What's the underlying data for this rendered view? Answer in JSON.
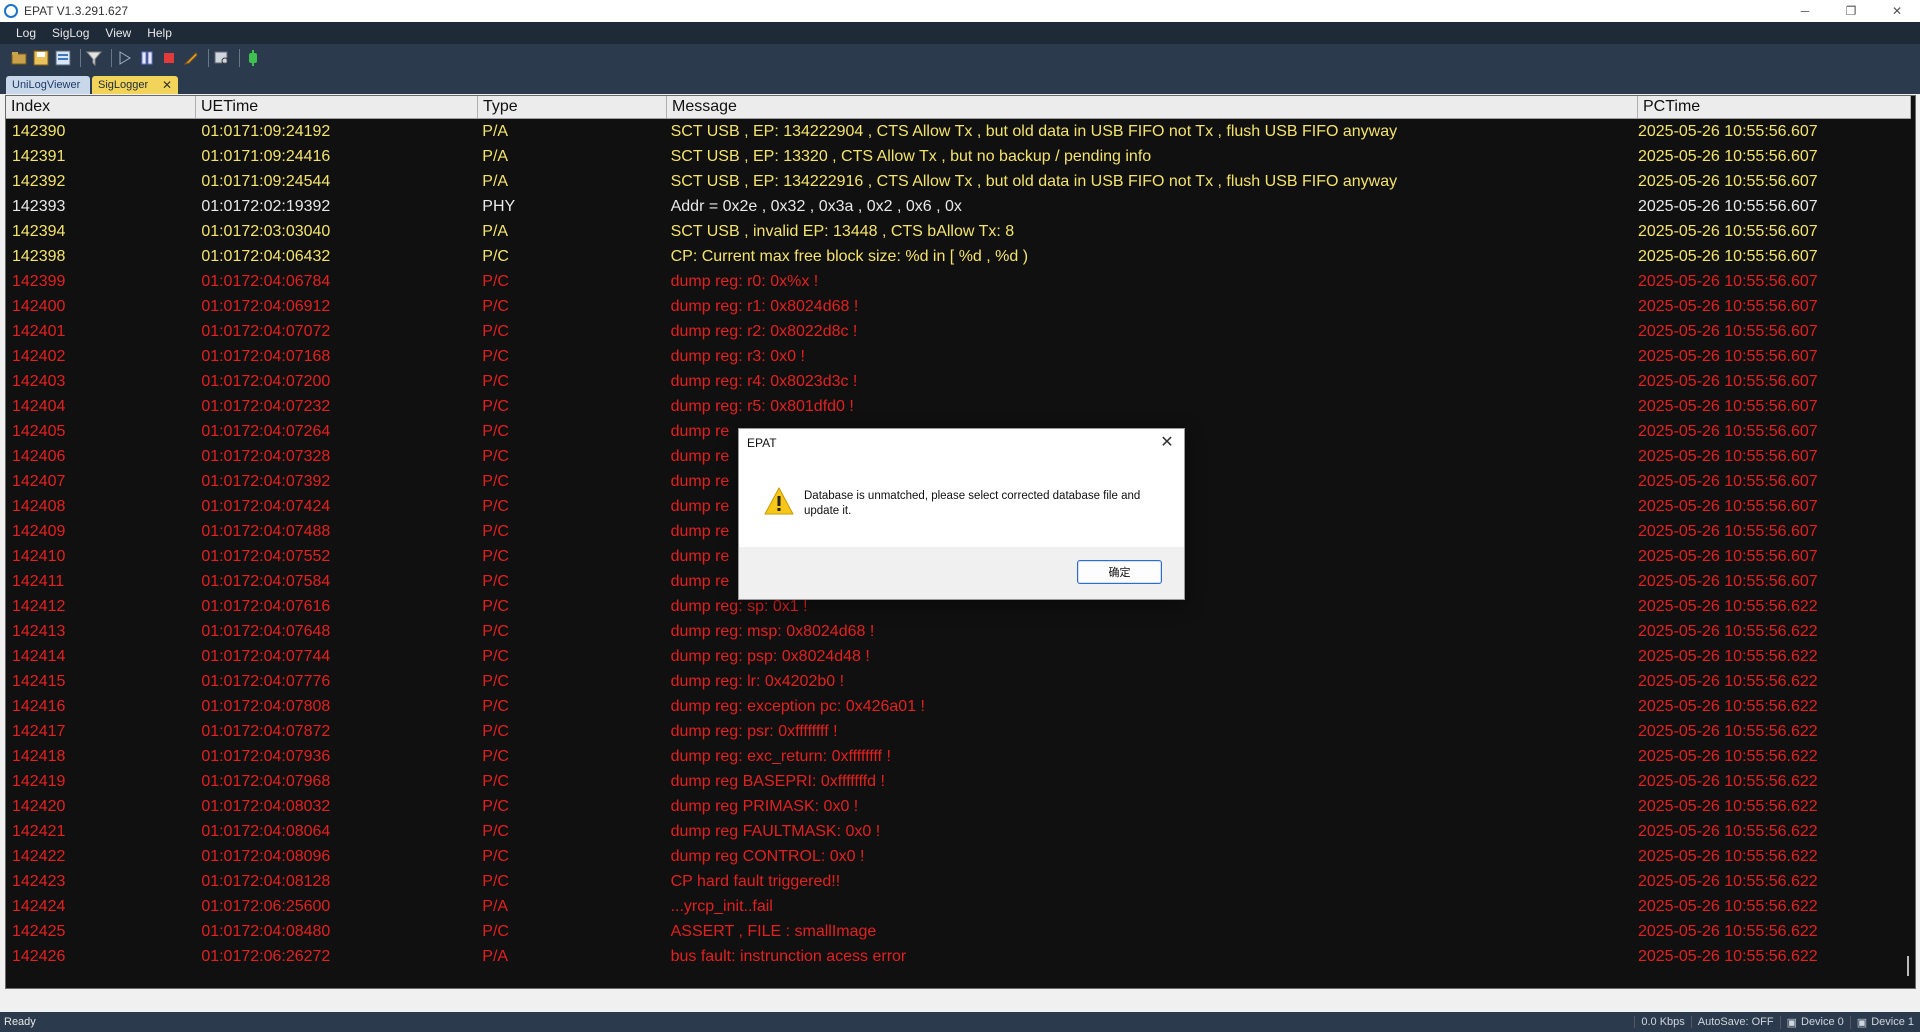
{
  "window": {
    "title": "EPAT V1.3.291.627",
    "controls": [
      "─",
      "❐",
      "✕"
    ]
  },
  "menu": {
    "items": [
      "Log",
      "SigLog",
      "View",
      "Help"
    ]
  },
  "toolbar": {
    "icons": [
      "open-folder-icon",
      "save-icon",
      "database-icon",
      "filter-icon",
      "play-icon",
      "pause-icon",
      "stop-icon",
      "tool-icon",
      "find-icon",
      "device-icon"
    ]
  },
  "tabs": [
    {
      "label": "UniLogViewer"
    },
    {
      "label": "SigLogger",
      "close": "✕"
    }
  ],
  "grid": {
    "columns": [
      "Index",
      "UETime",
      "Type",
      "Message",
      "PCTime"
    ],
    "rows": [
      {
        "level": "yellow",
        "index": "142390",
        "uetime": "01:0171:09:24192",
        "type": "P/A",
        "message": "SCT USB , EP: 134222904 , CTS Allow Tx , but old data in USB FIFO not Tx , flush USB FIFO anyway",
        "pctime": "2025-05-26 10:55:56.607"
      },
      {
        "level": "yellow",
        "index": "142391",
        "uetime": "01:0171:09:24416",
        "type": "P/A",
        "message": "SCT USB , EP: 13320 , CTS Allow Tx , but no backup / pending info",
        "pctime": "2025-05-26 10:55:56.607"
      },
      {
        "level": "yellow",
        "index": "142392",
        "uetime": "01:0171:09:24544",
        "type": "P/A",
        "message": "SCT USB , EP: 134222916 , CTS Allow Tx , but old data in USB FIFO not Tx , flush USB FIFO anyway",
        "pctime": "2025-05-26 10:55:56.607"
      },
      {
        "level": "white",
        "index": "142393",
        "uetime": "01:0172:02:19392",
        "type": "PHY",
        "message": "Addr = 0x2e , 0x32 , 0x3a , 0x2 , 0x6 , 0x",
        "pctime": "2025-05-26 10:55:56.607"
      },
      {
        "level": "yellow",
        "index": "142394",
        "uetime": "01:0172:03:03040",
        "type": "P/A",
        "message": "SCT USB , invalid EP: 13448 , CTS bAllow Tx: 8",
        "pctime": "2025-05-26 10:55:56.607"
      },
      {
        "level": "yellow",
        "index": "142398",
        "uetime": "01:0172:04:06432",
        "type": "P/C",
        "message": "CP: Current max free block size: %d in [ %d , %d )",
        "pctime": "2025-05-26 10:55:56.607"
      },
      {
        "level": "red",
        "index": "142399",
        "uetime": "01:0172:04:06784",
        "type": "P/C",
        "message": "dump reg: r0: 0x%x !",
        "pctime": "2025-05-26 10:55:56.607"
      },
      {
        "level": "red",
        "index": "142400",
        "uetime": "01:0172:04:06912",
        "type": "P/C",
        "message": "dump reg: r1: 0x8024d68 !",
        "pctime": "2025-05-26 10:55:56.607"
      },
      {
        "level": "red",
        "index": "142401",
        "uetime": "01:0172:04:07072",
        "type": "P/C",
        "message": "dump reg: r2: 0x8022d8c !",
        "pctime": "2025-05-26 10:55:56.607"
      },
      {
        "level": "red",
        "index": "142402",
        "uetime": "01:0172:04:07168",
        "type": "P/C",
        "message": "dump reg: r3: 0x0 !",
        "pctime": "2025-05-26 10:55:56.607"
      },
      {
        "level": "red",
        "index": "142403",
        "uetime": "01:0172:04:07200",
        "type": "P/C",
        "message": "dump reg: r4: 0x8023d3c !",
        "pctime": "2025-05-26 10:55:56.607"
      },
      {
        "level": "red",
        "index": "142404",
        "uetime": "01:0172:04:07232",
        "type": "P/C",
        "message": "dump reg: r5: 0x801dfd0 !",
        "pctime": "2025-05-26 10:55:56.607"
      },
      {
        "level": "red",
        "index": "142405",
        "uetime": "01:0172:04:07264",
        "type": "P/C",
        "message": "dump re",
        "pctime": "2025-05-26 10:55:56.607"
      },
      {
        "level": "red",
        "index": "142406",
        "uetime": "01:0172:04:07328",
        "type": "P/C",
        "message": "dump re",
        "pctime": "2025-05-26 10:55:56.607"
      },
      {
        "level": "red",
        "index": "142407",
        "uetime": "01:0172:04:07392",
        "type": "P/C",
        "message": "dump re",
        "pctime": "2025-05-26 10:55:56.607"
      },
      {
        "level": "red",
        "index": "142408",
        "uetime": "01:0172:04:07424",
        "type": "P/C",
        "message": "dump re",
        "pctime": "2025-05-26 10:55:56.607"
      },
      {
        "level": "red",
        "index": "142409",
        "uetime": "01:0172:04:07488",
        "type": "P/C",
        "message": "dump re",
        "pctime": "2025-05-26 10:55:56.607"
      },
      {
        "level": "red",
        "index": "142410",
        "uetime": "01:0172:04:07552",
        "type": "P/C",
        "message": "dump re",
        "pctime": "2025-05-26 10:55:56.607"
      },
      {
        "level": "red",
        "index": "142411",
        "uetime": "01:0172:04:07584",
        "type": "P/C",
        "message": "dump re",
        "pctime": "2025-05-26 10:55:56.607"
      },
      {
        "level": "red",
        "index": "142412",
        "uetime": "01:0172:04:07616",
        "type": "P/C",
        "message": "dump reg: sp: 0x1 !",
        "pctime": "2025-05-26 10:55:56.622"
      },
      {
        "level": "red",
        "index": "142413",
        "uetime": "01:0172:04:07648",
        "type": "P/C",
        "message": "dump reg: msp: 0x8024d68 !",
        "pctime": "2025-05-26 10:55:56.622"
      },
      {
        "level": "red",
        "index": "142414",
        "uetime": "01:0172:04:07744",
        "type": "P/C",
        "message": "dump reg: psp: 0x8024d48 !",
        "pctime": "2025-05-26 10:55:56.622"
      },
      {
        "level": "red",
        "index": "142415",
        "uetime": "01:0172:04:07776",
        "type": "P/C",
        "message": "dump reg: lr: 0x4202b0 !",
        "pctime": "2025-05-26 10:55:56.622"
      },
      {
        "level": "red",
        "index": "142416",
        "uetime": "01:0172:04:07808",
        "type": "P/C",
        "message": "dump reg: exception pc: 0x426a01 !",
        "pctime": "2025-05-26 10:55:56.622"
      },
      {
        "level": "red",
        "index": "142417",
        "uetime": "01:0172:04:07872",
        "type": "P/C",
        "message": "dump reg: psr: 0xffffffff !",
        "pctime": "2025-05-26 10:55:56.622"
      },
      {
        "level": "red",
        "index": "142418",
        "uetime": "01:0172:04:07936",
        "type": "P/C",
        "message": "dump reg: exc_return: 0xffffffff !",
        "pctime": "2025-05-26 10:55:56.622"
      },
      {
        "level": "red",
        "index": "142419",
        "uetime": "01:0172:04:07968",
        "type": "P/C",
        "message": "dump reg BASEPRI: 0xfffffffd !",
        "pctime": "2025-05-26 10:55:56.622"
      },
      {
        "level": "red",
        "index": "142420",
        "uetime": "01:0172:04:08032",
        "type": "P/C",
        "message": "dump reg PRIMASK: 0x0 !",
        "pctime": "2025-05-26 10:55:56.622"
      },
      {
        "level": "red",
        "index": "142421",
        "uetime": "01:0172:04:08064",
        "type": "P/C",
        "message": "dump reg FAULTMASK: 0x0 !",
        "pctime": "2025-05-26 10:55:56.622"
      },
      {
        "level": "red",
        "index": "142422",
        "uetime": "01:0172:04:08096",
        "type": "P/C",
        "message": "dump reg CONTROL: 0x0 !",
        "pctime": "2025-05-26 10:55:56.622"
      },
      {
        "level": "red",
        "index": "142423",
        "uetime": "01:0172:04:08128",
        "type": "P/C",
        "message": "CP hard fault triggered!!",
        "pctime": "2025-05-26 10:55:56.622"
      },
      {
        "level": "red",
        "index": "142424",
        "uetime": "01:0172:06:25600",
        "type": "P/A",
        "message": "...yrcp_init..fail",
        "pctime": "2025-05-26 10:55:56.622"
      },
      {
        "level": "red",
        "index": "142425",
        "uetime": "01:0172:04:08480",
        "type": "P/C",
        "message": "ASSERT , FILE : smallImage",
        "pctime": "2025-05-26 10:55:56.622"
      },
      {
        "level": "red",
        "index": "142426",
        "uetime": "01:0172:06:26272",
        "type": "P/A",
        "message": "bus fault: instrunction acess error",
        "pctime": "2025-05-26 10:55:56.622"
      }
    ]
  },
  "dialog": {
    "title": "EPAT",
    "message": "Database is unmatched, please select corrected database file and update it.",
    "ok_label": "确定",
    "close": "✕"
  },
  "status": {
    "left": "Ready",
    "speed": "0.0 Kbps",
    "autosave": "AutoSave: OFF",
    "device0": "Device 0",
    "device1": "Device 1"
  }
}
